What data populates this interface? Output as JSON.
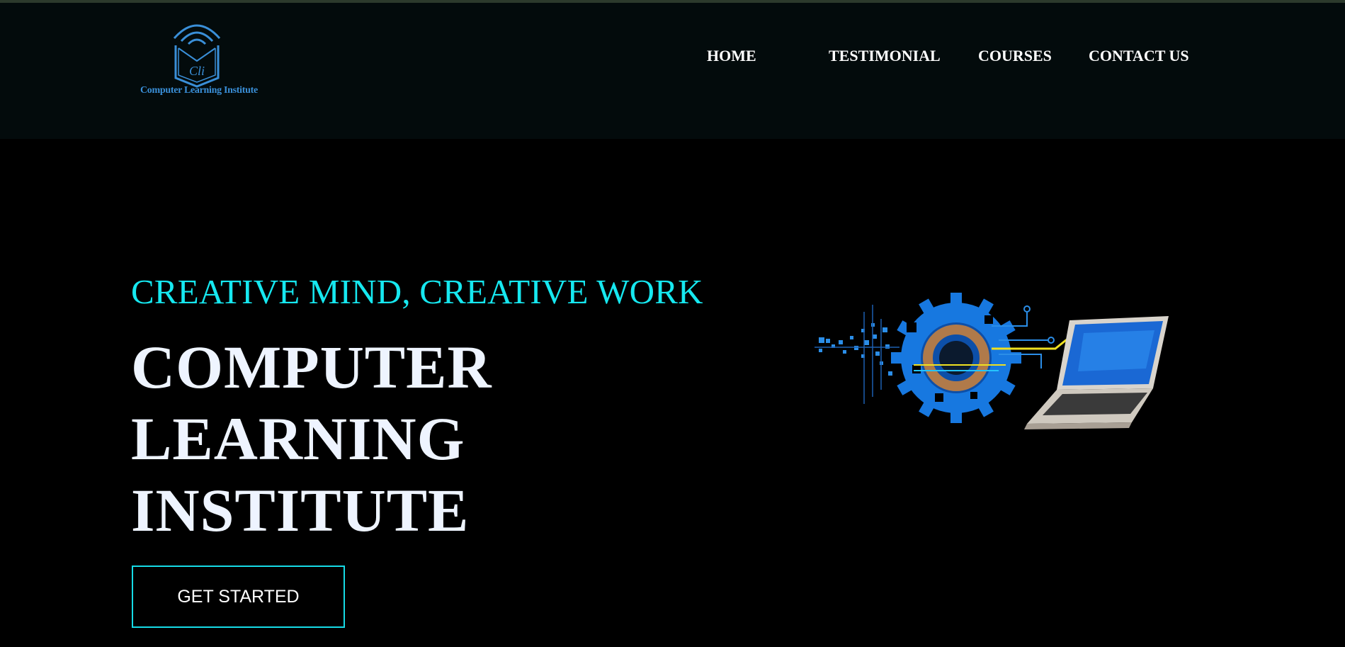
{
  "header": {
    "logo": {
      "monogram": "Cli",
      "text": "Computer Learning Institute",
      "icon": "book-wifi-icon"
    },
    "nav": [
      {
        "label": "HOME"
      },
      {
        "label": "TESTIMONIAL"
      },
      {
        "label": "COURSES"
      },
      {
        "label": "CONTACT US"
      }
    ]
  },
  "hero": {
    "tagline": "CREATIVE MIND, CREATIVE WORK",
    "title_lines": [
      "COMPUTER",
      "LEARNING",
      "INSTITUTE"
    ],
    "cta_label": "GET STARTED",
    "illustration": "gear-laptop-tech-illustration"
  },
  "colors": {
    "background": "#000000",
    "navbar": "#030b0c",
    "accent": "#16e8f0",
    "logo": "#3a8fd8",
    "text": "#ffffff"
  }
}
